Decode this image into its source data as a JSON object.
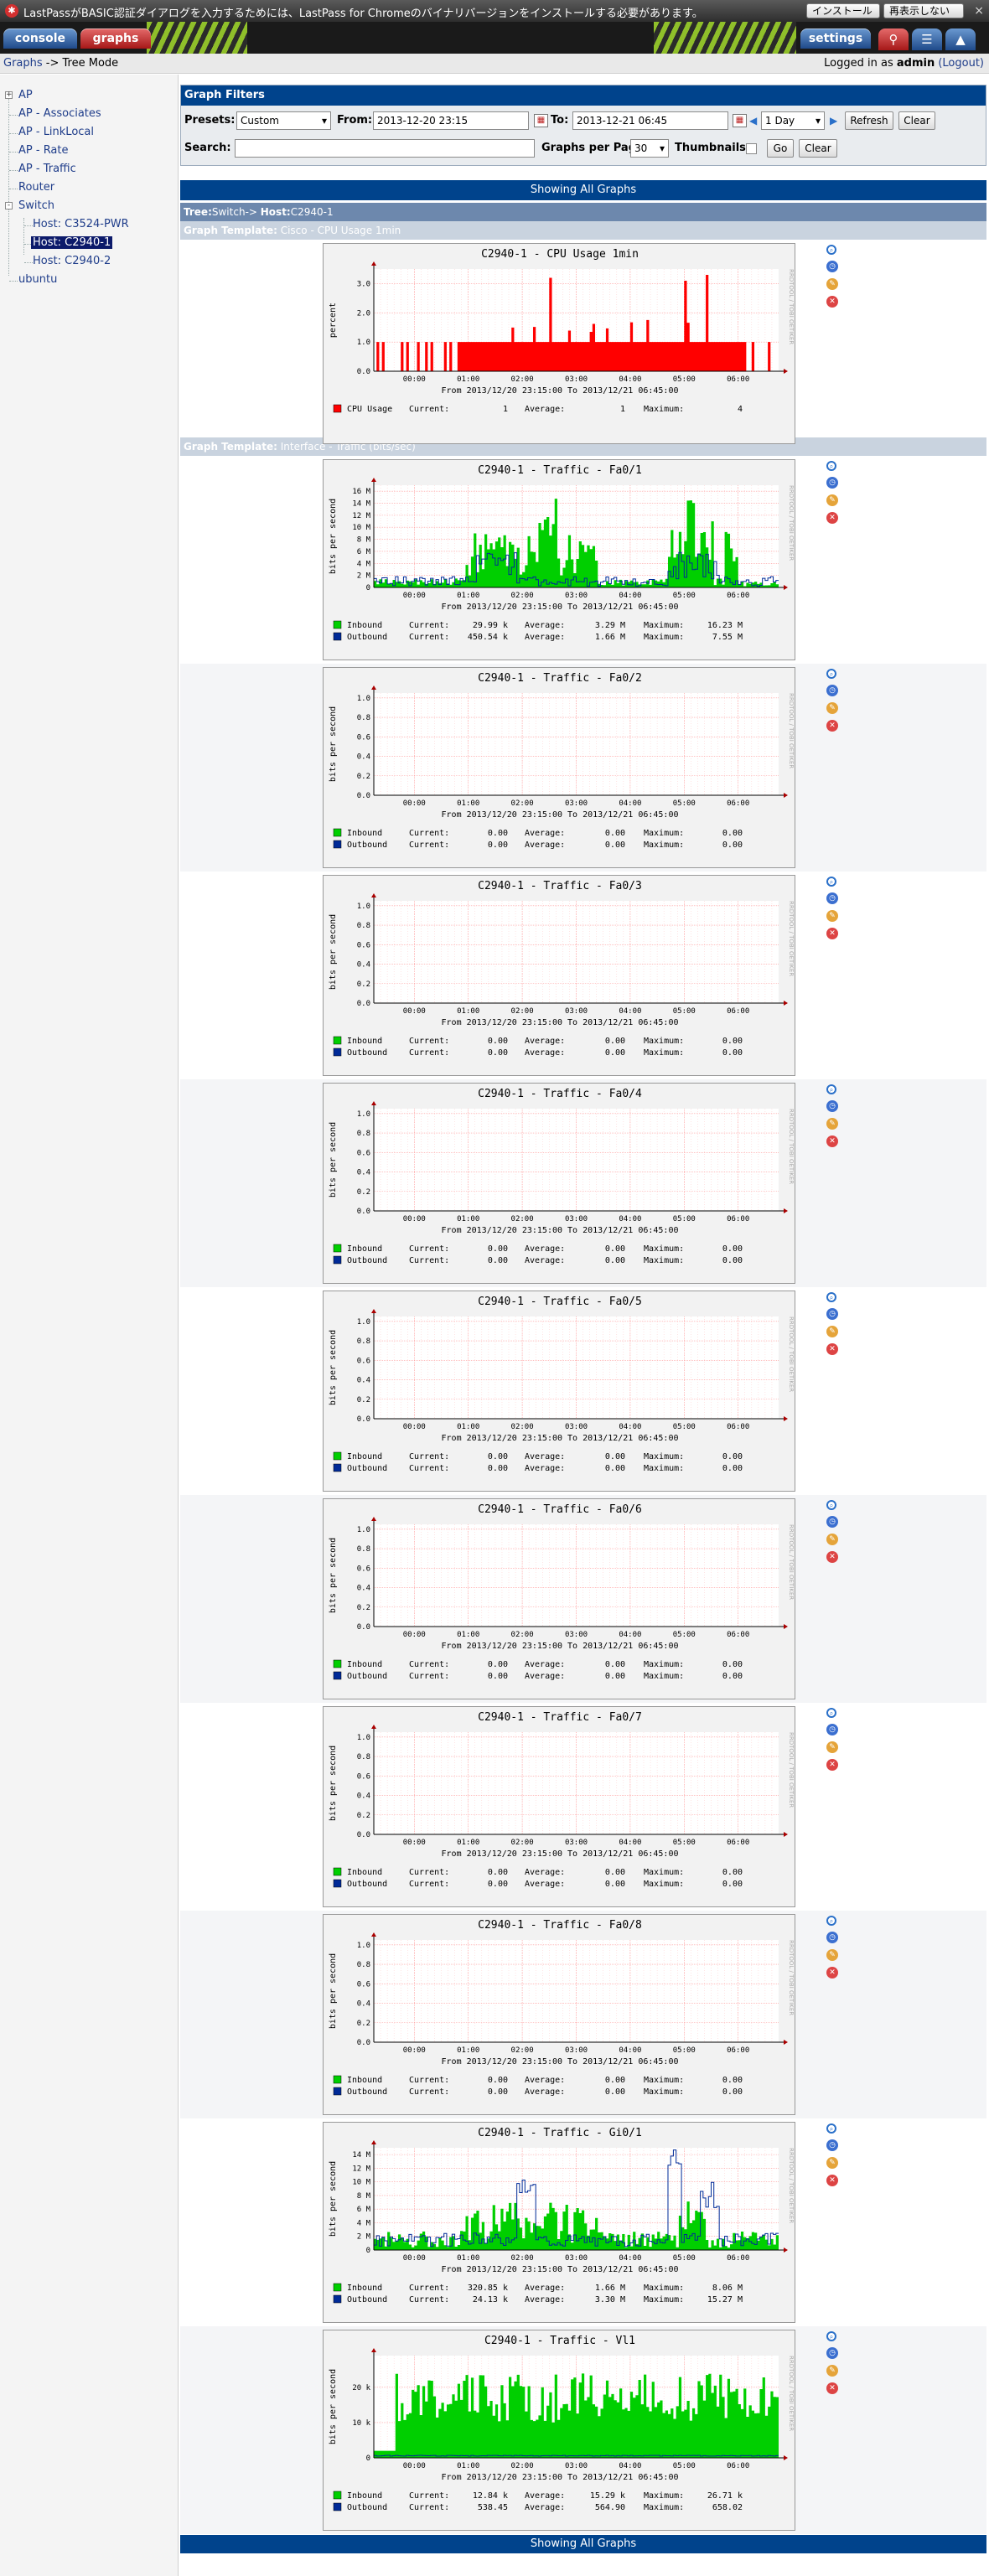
{
  "lastpass": {
    "message": "LastPassがBASIC認証ダイアログを入力するためには、LastPass for Chromeのバイナリバージョンをインストールする必要があります。",
    "install_label": "インストール",
    "dismiss_label": "再表示しない",
    "close": "×"
  },
  "tabs": {
    "console": "console",
    "graphs": "graphs",
    "settings": "settings"
  },
  "nav": {
    "breadcrumb_link": "Graphs",
    "breadcrumb_sep": " -> ",
    "breadcrumb_current": "Tree Mode",
    "logged_prefix": "Logged in as ",
    "user": "admin",
    "logout": "(Logout)"
  },
  "tree": {
    "items": [
      "AP",
      "AP - Associates",
      "AP - LinkLocal",
      "AP - Rate",
      "AP - Traffic",
      "Router",
      "Switch",
      "Host: C3524-PWR",
      "Host: C2940-1",
      "Host: C2940-2",
      "ubuntu"
    ],
    "toggle_plus": "+",
    "toggle_minus": "-"
  },
  "filters": {
    "title": "Graph Filters",
    "presets_label": "Presets:",
    "presets_value": "Custom",
    "from_label": "From:",
    "from_value": "2013-12-20 23:15",
    "to_label": "To:",
    "to_value": "2013-12-21 06:45",
    "span_value": "1 Day",
    "refresh": "Refresh",
    "clear": "Clear",
    "search_label": "Search:",
    "search_value": "",
    "gpp_label": "Graphs per Page:",
    "gpp_value": "30",
    "thumbs_label": "Thumbnails:",
    "go": "Go",
    "clear2": "Clear"
  },
  "showing_all": "Showing All Graphs",
  "treehost": {
    "tree_label": "Tree:",
    "tree_value": "Switch",
    "sep": "-> ",
    "host_label": "Host:",
    "host_value": "C2940-1"
  },
  "templates": {
    "label": "Graph Template:",
    "cpu": "Cisco - CPU Usage 1min",
    "traffic": "Interface - Traffic (bits/sec)"
  },
  "graph_common": {
    "time_label": "From 2013/12/20 23:15:00 To 2013/12/21 06:45:00",
    "xticks": [
      "00:00",
      "01:00",
      "02:00",
      "03:00",
      "04:00",
      "05:00",
      "06:00"
    ],
    "watermark": "RRDTOOL / TOBI OETIKER",
    "ylabel_traffic": "bits per second",
    "ylabel_cpu": "percent",
    "legend_in": "Inbound",
    "legend_out": "Outbound",
    "current": "Current:",
    "average": "Average:",
    "maximum": "Maximum:"
  },
  "colors": {
    "inbound": "#00cf00",
    "outbound": "#002a97",
    "cpu": "#ff0000",
    "header_blue": "#00438c"
  },
  "icons": [
    "zoom-icon",
    "timespan-icon",
    "edit-icon",
    "delete-icon"
  ],
  "graphs": [
    {
      "kind": "cpu",
      "title": "C2940-1 - CPU Usage 1min",
      "ylabel": "percent",
      "yticks": [
        "0.0",
        "1.0",
        "2.0",
        "3.0"
      ],
      "ymax": 3.5,
      "legend": [
        {
          "name": "CPU Usage",
          "current": "1",
          "average": "1",
          "maximum": "4"
        }
      ]
    },
    {
      "kind": "traffic",
      "title": "C2940-1 - Traffic - Fa0/1",
      "yticks": [
        "0",
        "2 M",
        "4 M",
        "6 M",
        "8 M",
        "10 M",
        "12 M",
        "14 M",
        "16 M"
      ],
      "ymax": 17,
      "preset": "fa01",
      "in": {
        "current": "29.99 k",
        "average": "3.29 M",
        "maximum": "16.23 M"
      },
      "out": {
        "current": "450.54 k",
        "average": "1.66 M",
        "maximum": "7.55 M"
      }
    },
    {
      "kind": "traffic",
      "title": "C2940-1 - Traffic - Fa0/2",
      "yticks": [
        "0.0",
        "0.2",
        "0.4",
        "0.6",
        "0.8",
        "1.0"
      ],
      "ymax": 1.05,
      "preset": "empty",
      "in": {
        "current": "0.00",
        "average": "0.00",
        "maximum": "0.00"
      },
      "out": {
        "current": "0.00",
        "average": "0.00",
        "maximum": "0.00"
      }
    },
    {
      "kind": "traffic",
      "title": "C2940-1 - Traffic - Fa0/3",
      "yticks": [
        "0.0",
        "0.2",
        "0.4",
        "0.6",
        "0.8",
        "1.0"
      ],
      "ymax": 1.05,
      "preset": "empty",
      "in": {
        "current": "0.00",
        "average": "0.00",
        "maximum": "0.00"
      },
      "out": {
        "current": "0.00",
        "average": "0.00",
        "maximum": "0.00"
      }
    },
    {
      "kind": "traffic",
      "title": "C2940-1 - Traffic - Fa0/4",
      "yticks": [
        "0.0",
        "0.2",
        "0.4",
        "0.6",
        "0.8",
        "1.0"
      ],
      "ymax": 1.05,
      "preset": "empty",
      "in": {
        "current": "0.00",
        "average": "0.00",
        "maximum": "0.00"
      },
      "out": {
        "current": "0.00",
        "average": "0.00",
        "maximum": "0.00"
      }
    },
    {
      "kind": "traffic",
      "title": "C2940-1 - Traffic - Fa0/5",
      "yticks": [
        "0.0",
        "0.2",
        "0.4",
        "0.6",
        "0.8",
        "1.0"
      ],
      "ymax": 1.05,
      "preset": "empty",
      "in": {
        "current": "0.00",
        "average": "0.00",
        "maximum": "0.00"
      },
      "out": {
        "current": "0.00",
        "average": "0.00",
        "maximum": "0.00"
      }
    },
    {
      "kind": "traffic",
      "title": "C2940-1 - Traffic - Fa0/6",
      "yticks": [
        "0.0",
        "0.2",
        "0.4",
        "0.6",
        "0.8",
        "1.0"
      ],
      "ymax": 1.05,
      "preset": "empty",
      "in": {
        "current": "0.00",
        "average": "0.00",
        "maximum": "0.00"
      },
      "out": {
        "current": "0.00",
        "average": "0.00",
        "maximum": "0.00"
      }
    },
    {
      "kind": "traffic",
      "title": "C2940-1 - Traffic - Fa0/7",
      "yticks": [
        "0.0",
        "0.2",
        "0.4",
        "0.6",
        "0.8",
        "1.0"
      ],
      "ymax": 1.05,
      "preset": "empty",
      "in": {
        "current": "0.00",
        "average": "0.00",
        "maximum": "0.00"
      },
      "out": {
        "current": "0.00",
        "average": "0.00",
        "maximum": "0.00"
      }
    },
    {
      "kind": "traffic",
      "title": "C2940-1 - Traffic - Fa0/8",
      "yticks": [
        "0.0",
        "0.2",
        "0.4",
        "0.6",
        "0.8",
        "1.0"
      ],
      "ymax": 1.05,
      "preset": "empty",
      "in": {
        "current": "0.00",
        "average": "0.00",
        "maximum": "0.00"
      },
      "out": {
        "current": "0.00",
        "average": "0.00",
        "maximum": "0.00"
      }
    },
    {
      "kind": "traffic",
      "title": "C2940-1 - Traffic - Gi0/1",
      "yticks": [
        "0",
        "2 M",
        "4 M",
        "6 M",
        "8 M",
        "10 M",
        "12 M",
        "14 M"
      ],
      "ymax": 15,
      "preset": "gi01",
      "in": {
        "current": "320.85 k",
        "average": "1.66 M",
        "maximum": "8.06 M"
      },
      "out": {
        "current": "24.13 k",
        "average": "3.30 M",
        "maximum": "15.27 M"
      }
    },
    {
      "kind": "traffic",
      "title": "C2940-1 - Traffic - Vl1",
      "yticks": [
        "0",
        "10 k",
        "20 k"
      ],
      "ymax": 29,
      "preset": "vl1",
      "in": {
        "current": "12.84 k",
        "average": "15.29 k",
        "maximum": "26.71 k"
      },
      "out": {
        "current": "538.45",
        "average": "564.90",
        "maximum": "658.02"
      }
    }
  ]
}
